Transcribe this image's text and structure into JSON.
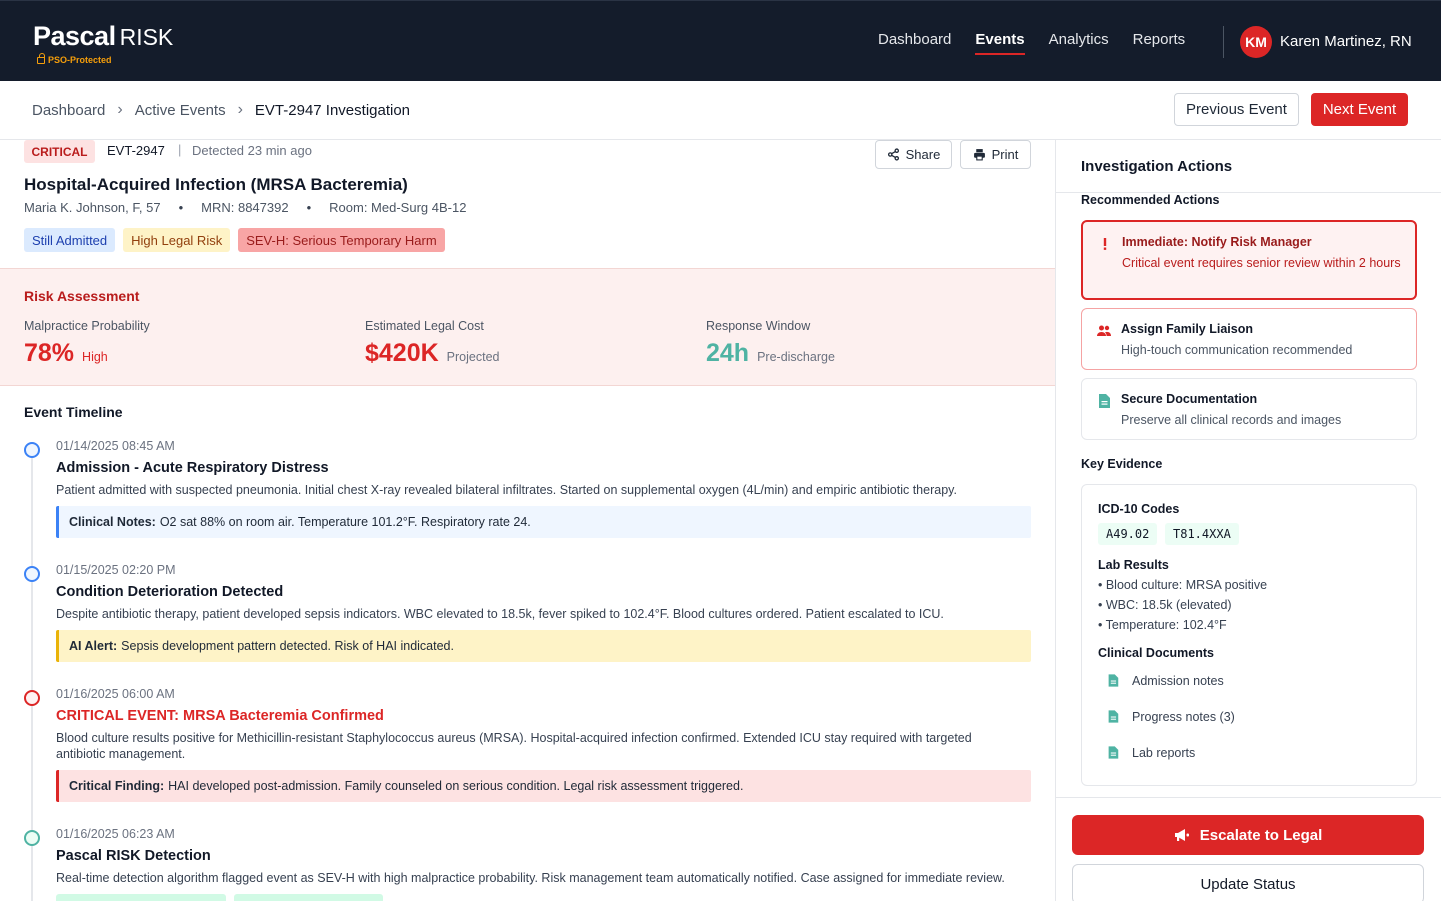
{
  "brand": {
    "name": "Pascal",
    "suffix": "RISK",
    "badge": "PSO-Protected"
  },
  "nav": {
    "links": [
      {
        "label": "Dashboard"
      },
      {
        "label": "Events"
      },
      {
        "label": "Analytics"
      },
      {
        "label": "Reports"
      }
    ],
    "active": "Events",
    "user": {
      "initials": "KM",
      "name": "Karen Martinez, RN"
    }
  },
  "breadcrumb": {
    "items": [
      "Dashboard",
      "Active Events",
      "EVT-2947 Investigation"
    ],
    "prev_label": "Previous Event",
    "next_label": "Next Event"
  },
  "event": {
    "severity": "CRITICAL",
    "id": "EVT-2947",
    "separator": "|",
    "detected": "Detected 23 min ago",
    "share_label": "Share",
    "print_label": "Print",
    "title": "Hospital-Acquired Infection (MRSA Bacteremia)",
    "patient": "Maria K. Johnson, F, 57",
    "mrn": "MRN: 8847392",
    "room": "Room: Med-Surg 4B-12",
    "dot": "•",
    "tags": [
      "Still Admitted",
      "High Legal Risk",
      "SEV-H: Serious Temporary Harm"
    ]
  },
  "risk": {
    "title": "Risk Assessment",
    "metrics": [
      {
        "label": "Malpractice Probability",
        "value": "78%",
        "sub": "High",
        "color": "#dc2626"
      },
      {
        "label": "Estimated Legal Cost",
        "value": "$420K",
        "sub": "Projected",
        "color": "#dc2626"
      },
      {
        "label": "Response Window",
        "value": "24h",
        "sub": "Pre-discharge",
        "color": "#4fb3a3"
      }
    ]
  },
  "timeline": {
    "title": "Event Timeline",
    "items": [
      {
        "time": "01/14/2025 08:45 AM",
        "title": "Admission - Acute Respiratory Distress",
        "desc": "Patient admitted with suspected pneumonia. Initial chest X-ray revealed bilateral infiltrates. Started on supplemental oxygen (4L/min) and empiric antibiotic therapy.",
        "note_label": "Clinical Notes:",
        "note": "O2 sat 88% on room air. Temperature 101.2°F. Respiratory rate 24.",
        "dot_color": "#3b82f6"
      },
      {
        "time": "01/15/2025 02:20 PM",
        "title": "Condition Deterioration Detected",
        "desc": "Despite antibiotic therapy, patient developed sepsis indicators. WBC elevated to 18.5k, fever spiked to 102.4°F. Blood cultures ordered. Patient escalated to ICU.",
        "note_label": "AI Alert:",
        "note": "Sepsis development pattern detected. Risk of HAI indicated.",
        "dot_color": "#3b82f6"
      },
      {
        "time": "01/16/2025 06:00 AM",
        "title": "CRITICAL EVENT: MRSA Bacteremia Confirmed",
        "desc": "Blood culture results positive for Methicillin-resistant Staphylococcus aureus (MRSA). Hospital-acquired infection confirmed. Extended ICU stay required with targeted antibiotic management.",
        "note_label": "Critical Finding:",
        "note": "HAI developed post-admission. Family counseled on serious condition. Legal risk assessment triggered.",
        "dot_color": "#dc2626"
      },
      {
        "time": "01/16/2025 06:23 AM",
        "title": "Pascal RISK Detection",
        "desc": "Real-time detection algorithm flagged event as SEV-H with high malpractice probability. Risk management team automatically notified. Case assigned for immediate review.",
        "dot_color": "#4fb3a3"
      }
    ]
  },
  "side": {
    "title": "Investigation Actions",
    "recommended_label": "Recommended Actions",
    "actions": [
      {
        "title": "Immediate: Notify Risk Manager",
        "desc": "Critical event requires senior review within 2 hours",
        "icon": "alert-icon"
      },
      {
        "title": "Assign Family Liaison",
        "desc": "High-touch communication recommended",
        "icon": "people-icon"
      },
      {
        "title": "Secure Documentation",
        "desc": "Preserve all clinical records and images",
        "icon": "document-icon"
      }
    ],
    "evidence_label": "Key Evidence",
    "icd_label": "ICD-10 Codes",
    "codes": [
      "A49.02",
      "T81.4XXA"
    ],
    "lab_label": "Lab Results",
    "labs": [
      "• Blood culture: MRSA positive",
      "• WBC: 18.5k (elevated)",
      "• Temperature: 102.4°F"
    ],
    "docs_label": "Clinical Documents",
    "docs": [
      "Admission notes",
      "Progress notes (3)",
      "Lab reports"
    ],
    "escalate_label": "Escalate to Legal",
    "status_label": "Update Status"
  },
  "colors": {
    "accent": "#dc2626",
    "nav_bg": "#141c2b",
    "teal": "#4fb3a3"
  }
}
